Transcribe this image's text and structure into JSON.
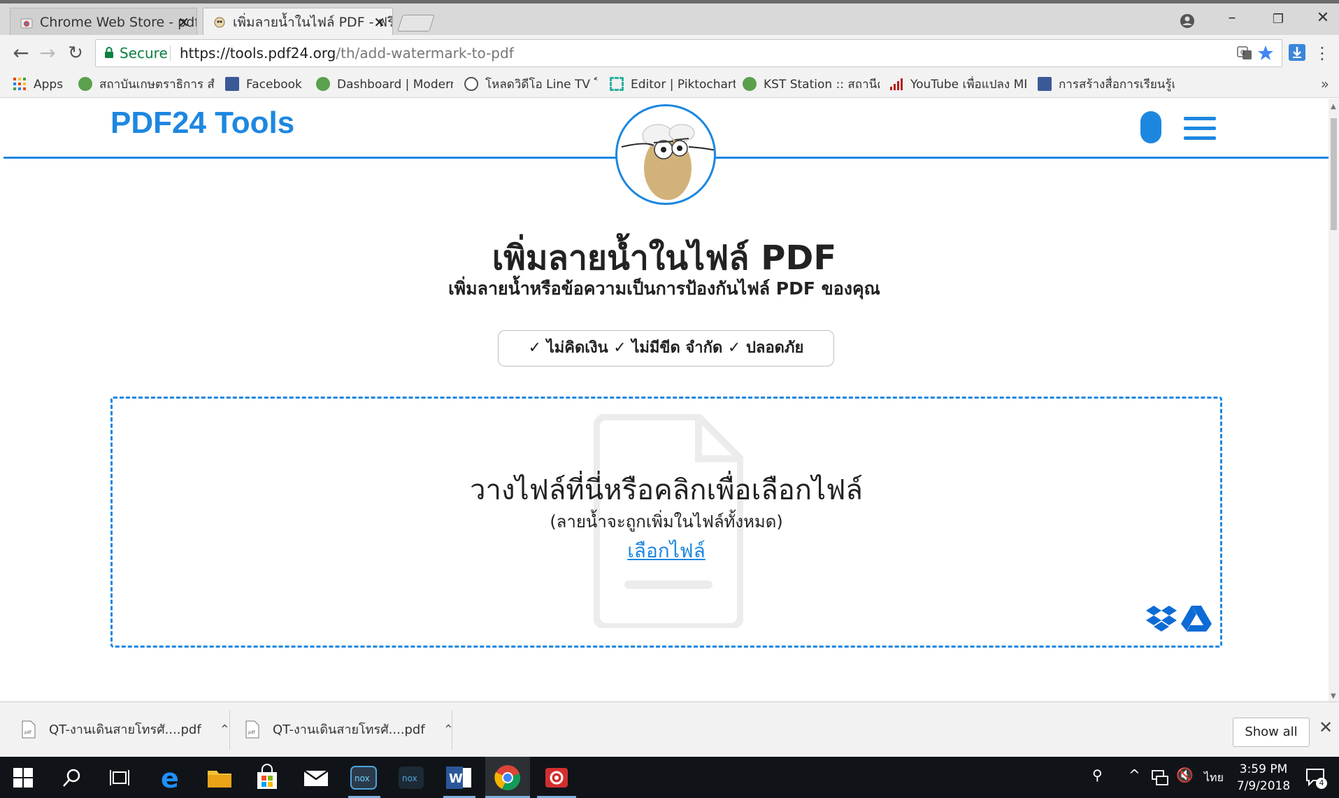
{
  "browser": {
    "tabs": [
      {
        "title": "Chrome Web Store - pdf",
        "active": false
      },
      {
        "title": "เพิ่มลายน้ำในไฟล์ PDF - ฟรี",
        "active": true
      }
    ],
    "omnibox": {
      "secure_label": "Secure",
      "url_host": "https://tools.pdf24.org",
      "url_path": "/th/add-watermark-to-pdf"
    },
    "bookmarks": [
      {
        "label": "Apps",
        "icon": "apps-grid-icon"
      },
      {
        "label": "สถาบันเกษตราธิการ สำ",
        "icon": "globe-icon"
      },
      {
        "label": "Facebook",
        "icon": "facebook-icon"
      },
      {
        "label": "Dashboard | Modern",
        "icon": "globe-icon"
      },
      {
        "label": "โหลดวิดีโอ Line TV โห",
        "icon": "clock-icon"
      },
      {
        "label": "Editor | Piktochart",
        "icon": "piktochart-icon"
      },
      {
        "label": "KST Station :: สถานีค",
        "icon": "globe-icon"
      },
      {
        "label": "YouTube เพื่อแปลง MP",
        "icon": "equalizer-icon"
      },
      {
        "label": "การสร้างสื่อการเรียนรู้แบ",
        "icon": "facebook-icon"
      }
    ]
  },
  "page": {
    "logo": "PDF24 Tools",
    "title": "เพิ่มลายน้ำในไฟล์ PDF",
    "subtitle": "เพิ่มลายน้ำหรือข้อความเป็นการป้องกันไฟล์ PDF ของคุณ",
    "badge": "✓ ไม่คิดเงิน  ✓ ไม่มีขีด จำกัด  ✓ ปลอดภัย",
    "dropzone": {
      "main": "วางไฟล์ที่นี่หรือคลิกเพื่อเลือกไฟล์",
      "sub": "(ลายน้ำจะถูกเพิ่มในไฟล์ทั้งหมด)",
      "link": "เลือกไฟล์"
    }
  },
  "downloads": {
    "items": [
      {
        "name": "QT-งานเดินสายโทรศั....pdf"
      },
      {
        "name": "QT-งานเดินสายโทรศั....pdf"
      }
    ],
    "show_all": "Show all"
  },
  "taskbar": {
    "time": "3:59 PM",
    "date": "7/9/2018",
    "lang": "ไทย",
    "notification_count": "4"
  },
  "colors": {
    "accent": "#1d87e0",
    "secure": "#0b8043"
  }
}
